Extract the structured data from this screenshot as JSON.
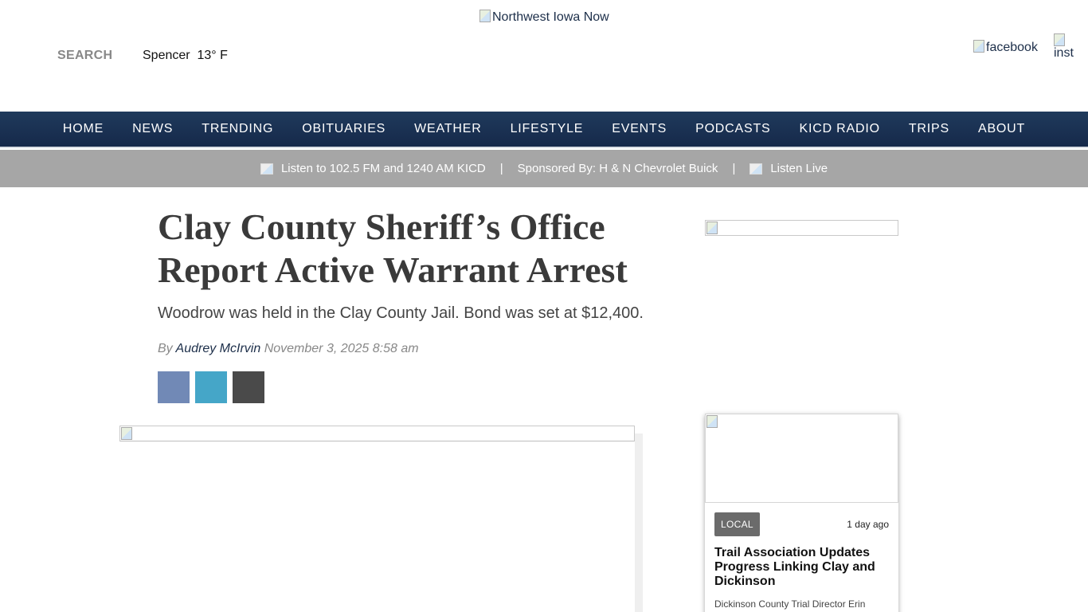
{
  "header": {
    "logo_alt": "Northwest Iowa Now",
    "search_label": "SEARCH",
    "weather": "Spencer  13° F",
    "social": {
      "facebook_alt": "facebook",
      "instagram_alt": "inst"
    }
  },
  "nav": {
    "items": [
      "HOME",
      "NEWS",
      "TRENDING",
      "OBITUARIES",
      "WEATHER",
      "LIFESTYLE",
      "EVENTS",
      "PODCASTS",
      "KICD RADIO",
      "TRIPS",
      "ABOUT"
    ]
  },
  "sponsor_bar": {
    "listen_fm": "Listen to 102.5 FM and 1240 AM KICD",
    "sponsor": "Sponsored By: H & N Chevrolet Buick",
    "listen_live": "Listen Live",
    "separator": "|"
  },
  "article": {
    "headline": "Clay County Sheriff’s Office Report Active Warrant Arrest",
    "subhead": "Woodrow was held in the Clay County Jail. Bond was set at $12,400.",
    "by": "By",
    "author": "Audrey McIrvin",
    "date": "November 3, 2025 8:58 am"
  },
  "sidebar": {
    "card": {
      "badge": "LOCAL",
      "time": "1 day ago",
      "title": "Trail Association Updates Progress Linking Clay and Dickinson",
      "text": "Dickinson County Trial Director Erin"
    }
  },
  "colors": {
    "nav_bg": "#1f3a5c",
    "sponsor_bg": "#a6a6a6",
    "share_facebook": "#7189b6",
    "share_twitter": "#45a6c8",
    "share_email": "#4a4a4a",
    "badge_bg": "#6b6b6b"
  },
  "icons": {
    "share": [
      "facebook-share-icon",
      "twitter-share-icon",
      "email-share-icon"
    ]
  }
}
